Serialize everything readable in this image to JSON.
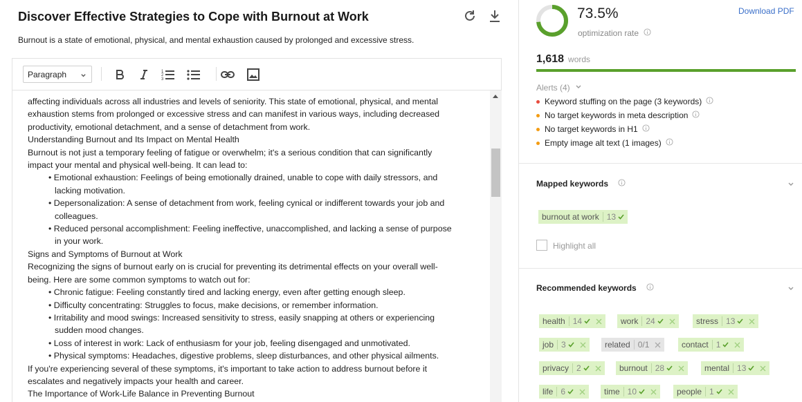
{
  "header": {
    "title": "Discover Effective Strategies to Cope with Burnout at Work",
    "description": "Burnout is a state of emotional, physical, and mental exhaustion caused by prolonged and excessive stress."
  },
  "toolbar": {
    "block_format": "Paragraph"
  },
  "editor_lines": [
    {
      "text": "affecting individuals across all industries and levels of seniority. This state of emotional, physical, and mental",
      "indent": false
    },
    {
      "text": "exhaustion stems from prolonged or excessive stress and can manifest in various ways, including decreased",
      "indent": false
    },
    {
      "text": "productivity, emotional detachment, and a sense of detachment from work.",
      "indent": false
    },
    {
      "text": "Understanding Burnout and Its Impact on Mental Health",
      "indent": false
    },
    {
      "text": "Burnout is not just a temporary feeling of fatigue or overwhelm; it's a serious condition that can significantly",
      "indent": false
    },
    {
      "text": "impact your mental and physical well-being. It can lead to:",
      "indent": false
    },
    {
      "text": "• Emotional exhaustion: Feelings of being emotionally drained, unable to cope with daily stressors, and",
      "indent": true
    },
    {
      "text": "lacking motivation.",
      "indent": true,
      "cont": true
    },
    {
      "text": "• Depersonalization: A sense of detachment from work, feeling cynical or indifferent towards your job and",
      "indent": true
    },
    {
      "text": "colleagues.",
      "indent": true,
      "cont": true
    },
    {
      "text": "• Reduced personal accomplishment: Feeling ineffective, unaccomplished, and lacking a sense of purpose",
      "indent": true
    },
    {
      "text": "in your work.",
      "indent": true,
      "cont": true
    },
    {
      "text": "Signs and Symptoms of Burnout at Work",
      "indent": false
    },
    {
      "text": "Recognizing the signs of burnout early on is crucial for preventing its detrimental effects on your overall well-",
      "indent": false
    },
    {
      "text": "being. Here are some common symptoms to watch out for:",
      "indent": false
    },
    {
      "text": "• Chronic fatigue: Feeling constantly tired and lacking energy, even after getting enough sleep.",
      "indent": true
    },
    {
      "text": "• Difficulty concentrating: Struggles to focus, make decisions, or remember information.",
      "indent": true
    },
    {
      "text": "• Irritability and mood swings: Increased sensitivity to stress, easily snapping at others or experiencing",
      "indent": true
    },
    {
      "text": "sudden mood changes.",
      "indent": true,
      "cont": true
    },
    {
      "text": "• Loss of interest in work: Lack of enthusiasm for your job, feeling disengaged and unmotivated.",
      "indent": true
    },
    {
      "text": "• Physical symptoms: Headaches, digestive problems, sleep disturbances, and other physical ailments.",
      "indent": true
    },
    {
      "text": "If you're experiencing several of these symptoms, it's important to take action to address burnout before it",
      "indent": false
    },
    {
      "text": "escalates and negatively impacts your health and career.",
      "indent": false
    },
    {
      "text": "The Importance of Work-Life Balance in Preventing Burnout",
      "indent": false
    }
  ],
  "stats": {
    "rate": "73.5%",
    "rate_value": 73.5,
    "rate_label": "optimization rate",
    "download_label": "Download PDF",
    "word_count": "1,618",
    "words_label": "words",
    "accent": "#5aa02c"
  },
  "alerts": {
    "header": "Alerts (4)",
    "items": [
      {
        "text": "Keyword stuffing on the page (3 keywords)",
        "color": "#e84c3d"
      },
      {
        "text": "No target keywords in meta description",
        "color": "#f39c12"
      },
      {
        "text": "No target keywords in H1",
        "color": "#f39c12"
      },
      {
        "text": "Empty image alt text (1 images)",
        "color": "#f39c12"
      }
    ]
  },
  "mapped": {
    "title": "Mapped keywords",
    "keywords": [
      {
        "kw": "burnout at work",
        "count": "13"
      }
    ],
    "highlight_label": "Highlight all"
  },
  "recommended": {
    "title": "Recommended keywords",
    "keywords": [
      {
        "kw": "health",
        "count": "14",
        "status": "ok"
      },
      {
        "kw": "work",
        "count": "24",
        "status": "ok"
      },
      {
        "kw": "stress",
        "count": "13",
        "status": "ok"
      },
      {
        "kw": "job",
        "count": "3",
        "status": "ok"
      },
      {
        "kw": "related",
        "count": "0/1",
        "status": "missing"
      },
      {
        "kw": "contact",
        "count": "1",
        "status": "ok"
      },
      {
        "kw": "privacy",
        "count": "2",
        "status": "ok"
      },
      {
        "kw": "burnout",
        "count": "28",
        "status": "ok"
      },
      {
        "kw": "mental",
        "count": "13",
        "status": "ok"
      },
      {
        "kw": "life",
        "count": "6",
        "status": "ok"
      },
      {
        "kw": "time",
        "count": "10",
        "status": "ok"
      },
      {
        "kw": "people",
        "count": "1",
        "status": "ok"
      }
    ]
  }
}
